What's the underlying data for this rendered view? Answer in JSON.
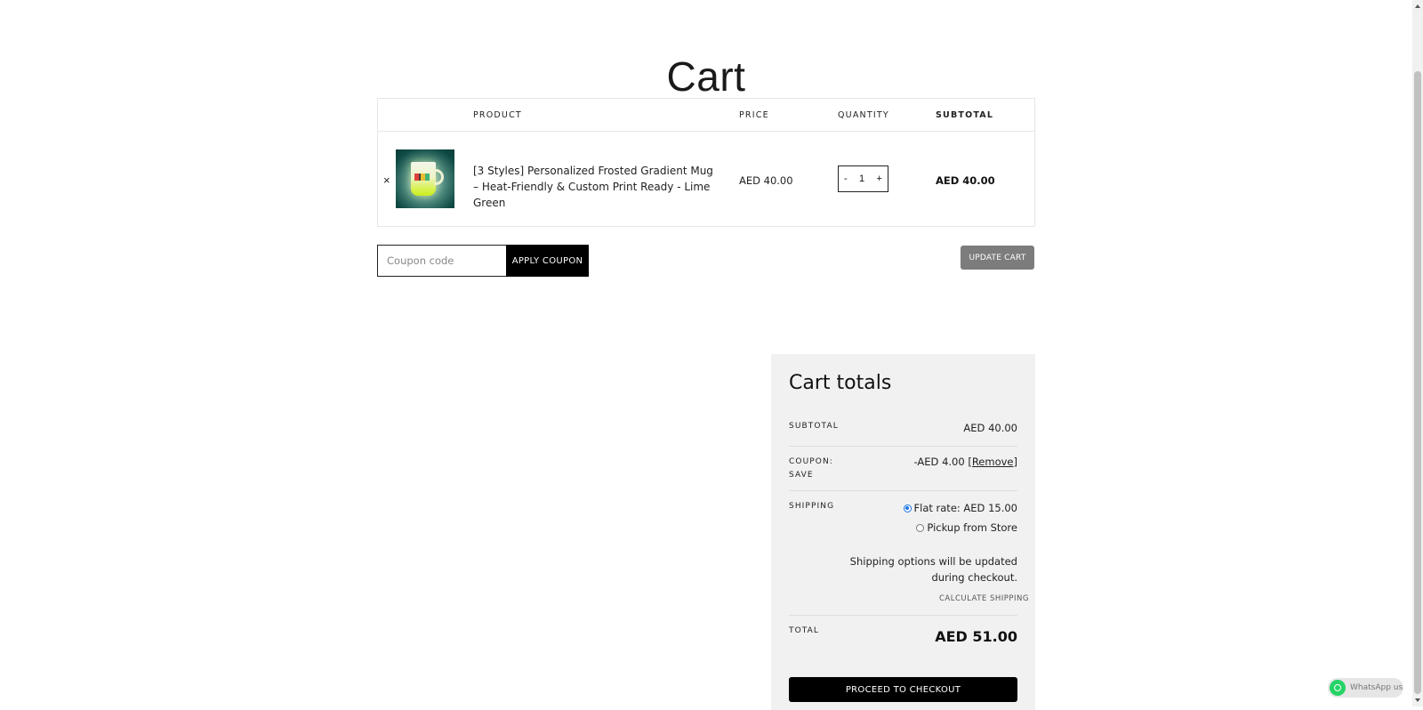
{
  "page": {
    "title": "Cart"
  },
  "cart_table": {
    "headers": {
      "product": "PRODUCT",
      "price": "PRICE",
      "quantity": "QUANTITY",
      "subtotal": "SUBTOTAL"
    },
    "items": [
      {
        "remove_symbol": "×",
        "name": "[3 Styles] Personalized Frosted Gradient Mug – Heat-Friendly & Custom Print Ready - Lime Green",
        "price": "AED 40.00",
        "quantity": "1",
        "minus": "-",
        "plus": "+",
        "subtotal": "AED 40.00"
      }
    ]
  },
  "coupon": {
    "placeholder": "Coupon code",
    "apply_label": "APPLY COUPON"
  },
  "update_cart_label": "UPDATE CART",
  "totals": {
    "title": "Cart totals",
    "subtotal_label": "SUBTOTAL",
    "subtotal_value": "AED 40.00",
    "coupon_label_line1": "COUPON:",
    "coupon_label_line2": "SAVE",
    "coupon_value": "-AED 4.00",
    "coupon_remove": "[Remove]",
    "shipping_label": "SHIPPING",
    "shipping_options": [
      {
        "label": "Flat rate: AED 15.00",
        "selected": true
      },
      {
        "label": "Pickup from Store",
        "selected": false
      }
    ],
    "shipping_note": "Shipping options will be updated during checkout.",
    "calculate_shipping": "CALCULATE SHIPPING",
    "total_label": "TOTAL",
    "total_value": "AED 51.00",
    "checkout_label": "PROCEED TO CHECKOUT"
  },
  "whatsapp": {
    "label": "WhatsApp us",
    "color": "#25d366"
  },
  "colors": {
    "primary_button": "#000000",
    "update_button": "#7c7c7c",
    "totals_bg": "#f1f1f1",
    "radio_accent": "#1a73e8"
  }
}
